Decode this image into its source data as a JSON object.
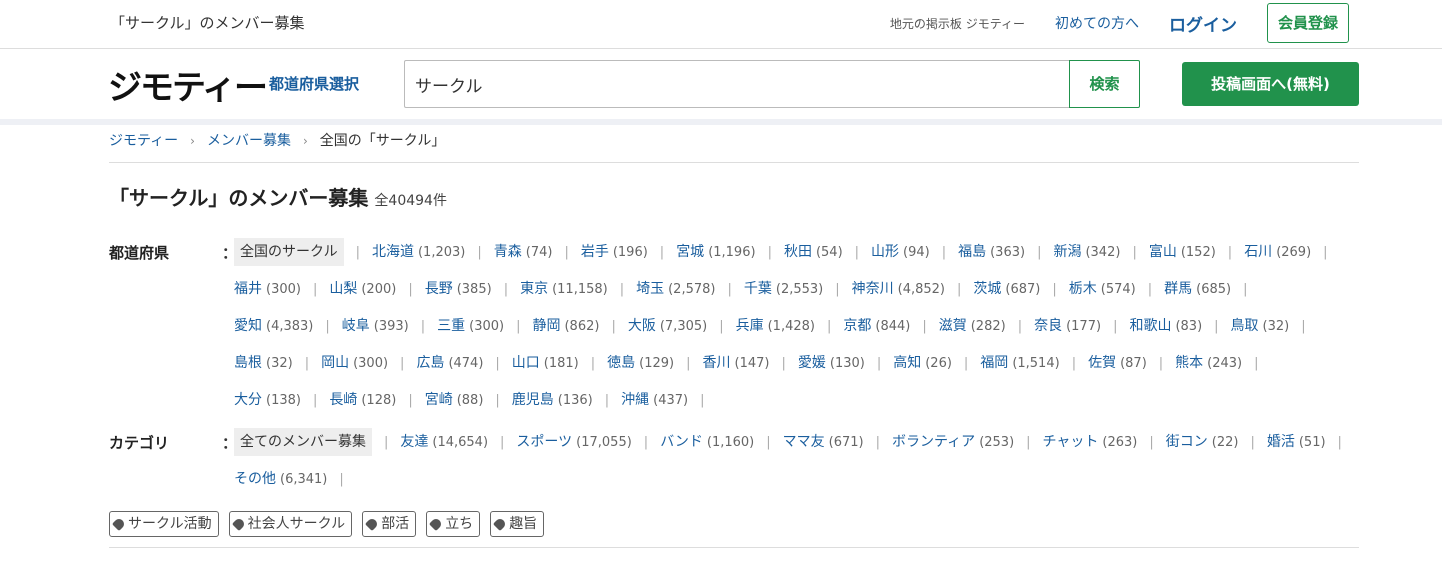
{
  "topbar": {
    "tagline": "「サークル」のメンバー募集",
    "site_desc": "地元の掲示板 ジモティー",
    "beginner": "初めての方へ",
    "login": "ログイン",
    "register": "会員登録"
  },
  "header": {
    "logo": "ジモティー",
    "pref_select": "都道府県選択",
    "search_value": "サークル",
    "search_button": "検索",
    "post_button": "投稿画面へ(無料)"
  },
  "breadcrumb": [
    "ジモティー",
    "メンバー募集",
    "全国の「サークル」"
  ],
  "page_title": {
    "title": "「サークル」のメンバー募集",
    "count": "全40494件"
  },
  "prefectures": {
    "label": "都道府県",
    "colon": "：",
    "items": [
      {
        "name": "全国のサークル",
        "count": "",
        "selected": true
      },
      {
        "name": "北海道",
        "count": "(1,203)"
      },
      {
        "name": "青森",
        "count": "(74)"
      },
      {
        "name": "岩手",
        "count": "(196)"
      },
      {
        "name": "宮城",
        "count": "(1,196)"
      },
      {
        "name": "秋田",
        "count": "(54)"
      },
      {
        "name": "山形",
        "count": "(94)"
      },
      {
        "name": "福島",
        "count": "(363)"
      },
      {
        "name": "新潟",
        "count": "(342)"
      },
      {
        "name": "富山",
        "count": "(152)"
      },
      {
        "name": "石川",
        "count": "(269)"
      },
      {
        "name": "福井",
        "count": "(300)"
      },
      {
        "name": "山梨",
        "count": "(200)"
      },
      {
        "name": "長野",
        "count": "(385)"
      },
      {
        "name": "東京",
        "count": "(11,158)"
      },
      {
        "name": "埼玉",
        "count": "(2,578)"
      },
      {
        "name": "千葉",
        "count": "(2,553)"
      },
      {
        "name": "神奈川",
        "count": "(4,852)"
      },
      {
        "name": "茨城",
        "count": "(687)"
      },
      {
        "name": "栃木",
        "count": "(574)"
      },
      {
        "name": "群馬",
        "count": "(685)"
      },
      {
        "name": "愛知",
        "count": "(4,383)"
      },
      {
        "name": "岐阜",
        "count": "(393)"
      },
      {
        "name": "三重",
        "count": "(300)"
      },
      {
        "name": "静岡",
        "count": "(862)"
      },
      {
        "name": "大阪",
        "count": "(7,305)"
      },
      {
        "name": "兵庫",
        "count": "(1,428)"
      },
      {
        "name": "京都",
        "count": "(844)"
      },
      {
        "name": "滋賀",
        "count": "(282)"
      },
      {
        "name": "奈良",
        "count": "(177)"
      },
      {
        "name": "和歌山",
        "count": "(83)"
      },
      {
        "name": "鳥取",
        "count": "(32)"
      },
      {
        "name": "島根",
        "count": "(32)"
      },
      {
        "name": "岡山",
        "count": "(300)"
      },
      {
        "name": "広島",
        "count": "(474)"
      },
      {
        "name": "山口",
        "count": "(181)"
      },
      {
        "name": "徳島",
        "count": "(129)"
      },
      {
        "name": "香川",
        "count": "(147)"
      },
      {
        "name": "愛媛",
        "count": "(130)"
      },
      {
        "name": "高知",
        "count": "(26)"
      },
      {
        "name": "福岡",
        "count": "(1,514)"
      },
      {
        "name": "佐賀",
        "count": "(87)"
      },
      {
        "name": "熊本",
        "count": "(243)"
      },
      {
        "name": "大分",
        "count": "(138)"
      },
      {
        "name": "長崎",
        "count": "(128)"
      },
      {
        "name": "宮崎",
        "count": "(88)"
      },
      {
        "name": "鹿児島",
        "count": "(136)"
      },
      {
        "name": "沖縄",
        "count": "(437)"
      }
    ]
  },
  "categories": {
    "label": "カテゴリ",
    "colon": "：",
    "items": [
      {
        "name": "全てのメンバー募集",
        "count": "",
        "selected": true
      },
      {
        "name": "友達",
        "count": "(14,654)"
      },
      {
        "name": "スポーツ",
        "count": "(17,055)"
      },
      {
        "name": "バンド",
        "count": "(1,160)"
      },
      {
        "name": "ママ友",
        "count": "(671)"
      },
      {
        "name": "ボランティア",
        "count": "(253)"
      },
      {
        "name": "チャット",
        "count": "(263)"
      },
      {
        "name": "街コン",
        "count": "(22)"
      },
      {
        "name": "婚活",
        "count": "(51)"
      },
      {
        "name": "その他",
        "count": "(6,341)"
      }
    ]
  },
  "tags": [
    "サークル活動",
    "社会人サークル",
    "部活",
    "立ち",
    "趣旨"
  ]
}
